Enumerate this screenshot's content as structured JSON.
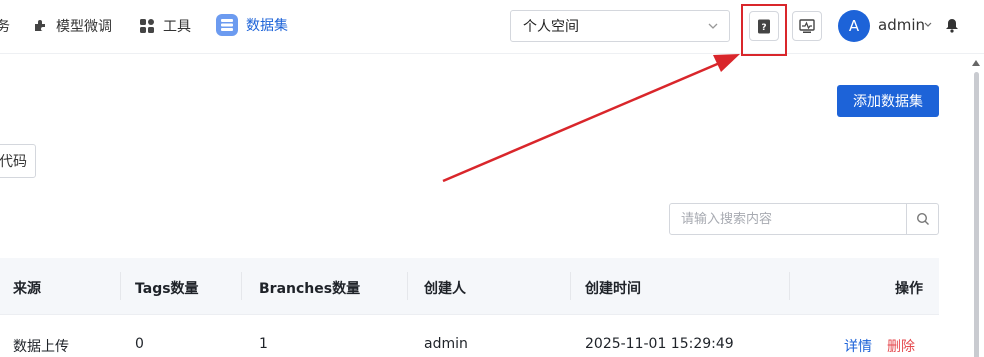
{
  "nav": {
    "partial_label": "务",
    "finetune_label": "模型微调",
    "tools_label": "工具",
    "dataset_label": "数据集"
  },
  "space_select": {
    "value": "个人空间"
  },
  "user": {
    "avatar_letter": "A",
    "name": "admin"
  },
  "main": {
    "add_dataset_label": "添加数据集",
    "code_button_label": "代码",
    "search_placeholder": "请输入搜索内容"
  },
  "table": {
    "headers": {
      "source": "来源",
      "tags": "Tags数量",
      "branches": "Branches数量",
      "creator": "创建人",
      "created_at": "创建时间",
      "actions": "操作"
    },
    "rows": [
      {
        "source": "数据上传",
        "tags": "0",
        "branches": "1",
        "creator": "admin",
        "created_at": "2025-11-01 15:29:49",
        "detail_label": "详情",
        "delete_label": "删除"
      }
    ]
  },
  "colors": {
    "primary": "#1d63d8",
    "danger": "#e5484d",
    "highlight": "#d9262b"
  },
  "annotations": {
    "highlighted_element": "help-button",
    "arrow": "pointing-to-help-button"
  }
}
